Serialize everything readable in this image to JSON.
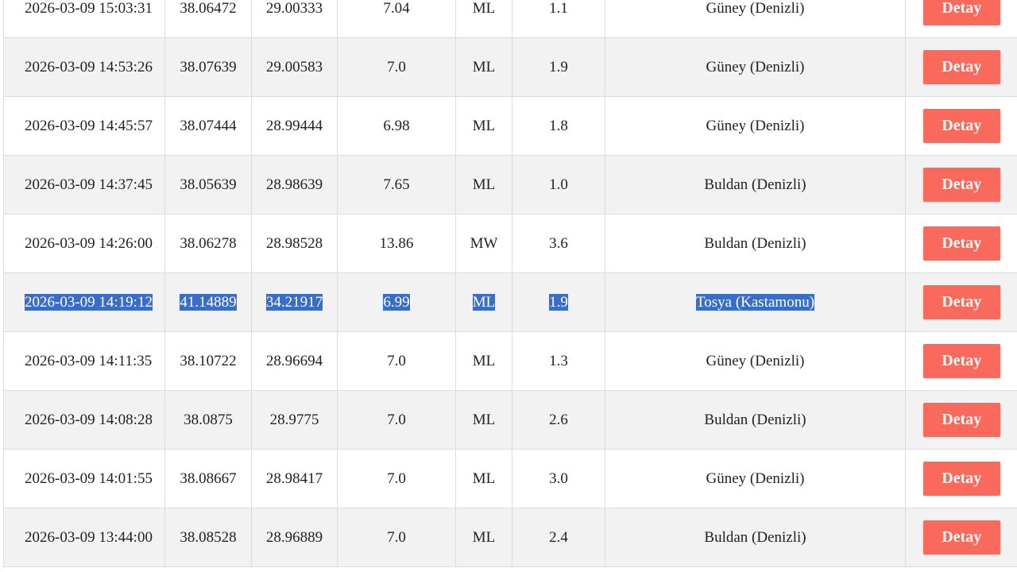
{
  "button_label": "Detay",
  "colors": {
    "button_bg": "#f96a5c",
    "selection_bg": "#3a6dc5",
    "row_alt_bg": "#f2f2f2"
  },
  "rows": [
    {
      "time": "2026-03-09 15:03:31",
      "lat": "38.06472",
      "lon": "29.00333",
      "depth": "7.04",
      "type": "ML",
      "mag": "1.1",
      "location": "Güney (Denizli)",
      "alt": false,
      "selected": false
    },
    {
      "time": "2026-03-09 14:53:26",
      "lat": "38.07639",
      "lon": "29.00583",
      "depth": "7.0",
      "type": "ML",
      "mag": "1.9",
      "location": "Güney (Denizli)",
      "alt": true,
      "selected": false
    },
    {
      "time": "2026-03-09 14:45:57",
      "lat": "38.07444",
      "lon": "28.99444",
      "depth": "6.98",
      "type": "ML",
      "mag": "1.8",
      "location": "Güney (Denizli)",
      "alt": false,
      "selected": false
    },
    {
      "time": "2026-03-09 14:37:45",
      "lat": "38.05639",
      "lon": "28.98639",
      "depth": "7.65",
      "type": "ML",
      "mag": "1.0",
      "location": "Buldan (Denizli)",
      "alt": true,
      "selected": false
    },
    {
      "time": "2026-03-09 14:26:00",
      "lat": "38.06278",
      "lon": "28.98528",
      "depth": "13.86",
      "type": "MW",
      "mag": "3.6",
      "location": "Buldan (Denizli)",
      "alt": false,
      "selected": false
    },
    {
      "time": "2026-03-09 14:19:12",
      "lat": "41.14889",
      "lon": "34.21917",
      "depth": "6.99",
      "type": "ML",
      "mag": "1.9",
      "location": "Tosya (Kastamonu)",
      "alt": true,
      "selected": true
    },
    {
      "time": "2026-03-09 14:11:35",
      "lat": "38.10722",
      "lon": "28.96694",
      "depth": "7.0",
      "type": "ML",
      "mag": "1.3",
      "location": "Güney (Denizli)",
      "alt": false,
      "selected": false
    },
    {
      "time": "2026-03-09 14:08:28",
      "lat": "38.0875",
      "lon": "28.9775",
      "depth": "7.0",
      "type": "ML",
      "mag": "2.6",
      "location": "Buldan (Denizli)",
      "alt": true,
      "selected": false
    },
    {
      "time": "2026-03-09 14:01:55",
      "lat": "38.08667",
      "lon": "28.98417",
      "depth": "7.0",
      "type": "ML",
      "mag": "3.0",
      "location": "Güney (Denizli)",
      "alt": false,
      "selected": false
    },
    {
      "time": "2026-03-09 13:44:00",
      "lat": "38.08528",
      "lon": "28.96889",
      "depth": "7.0",
      "type": "ML",
      "mag": "2.4",
      "location": "Buldan (Denizli)",
      "alt": true,
      "selected": false
    }
  ]
}
